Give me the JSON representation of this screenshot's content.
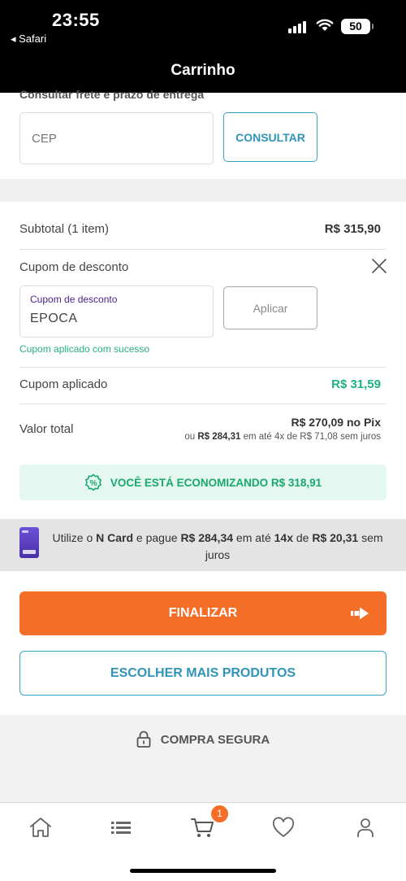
{
  "status_bar": {
    "time": "23:55",
    "back_app": "◂ Safari",
    "battery": "50"
  },
  "header": {
    "title": "Carrinho"
  },
  "shipping": {
    "label": "Consultar frete e prazo de entrega",
    "cep_placeholder": "CEP",
    "button": "CONSULTAR"
  },
  "summary": {
    "subtotal_label": "Subtotal (1 item)",
    "subtotal_value": "R$ 315,90",
    "coupon_label": "Cupom de desconto",
    "coupon_field_label": "Cupom de desconto",
    "coupon_value": "EPOCA",
    "apply_button": "Aplicar",
    "coupon_success": "Cupom aplicado com sucesso",
    "applied_label": "Cupom aplicado",
    "applied_value": "R$ 31,59",
    "total_label": "Valor total",
    "total_pix": "R$ 270,09 no Pix",
    "total_installments_prefix": "ou ",
    "total_installments_amount": "R$ 284,31",
    "total_installments_suffix": " em até 4x de R$ 71,08 sem juros"
  },
  "savings": {
    "text": "VOCÊ ESTÁ ECONOMIZANDO R$ 318,91"
  },
  "ncard": {
    "t1": "Utilize o ",
    "t2": "N Card",
    "t3": " e pague ",
    "t4": "R$ 284,34",
    "t5": " em até ",
    "t6": "14x",
    "t7": " de ",
    "t8": "R$ 20,31",
    "t9": " sem juros"
  },
  "actions": {
    "finalizar": "FINALIZAR",
    "escolher": "ESCOLHER MAIS PRODUTOS"
  },
  "secure": {
    "label": "COMPRA SEGURA"
  },
  "tabbar": {
    "cart_badge": "1"
  },
  "colors": {
    "orange": "#f56e28",
    "blue": "#2f94b9",
    "green": "#1fb27a"
  }
}
